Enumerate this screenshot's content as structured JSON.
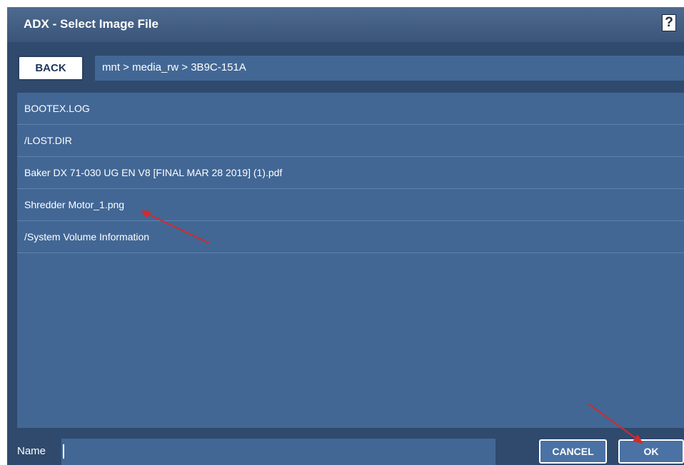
{
  "dialog": {
    "title": "ADX - Select Image File",
    "help_label": "?"
  },
  "navigation": {
    "back_label": "BACK",
    "path": "mnt > media_rw > 3B9C-151A"
  },
  "files": [
    "BOOTEX.LOG",
    "/LOST.DIR",
    "Baker DX 71-030 UG EN V8 [FINAL MAR 28 2019] (1).pdf",
    "Shredder Motor_1.png",
    "/System Volume Information"
  ],
  "footer": {
    "name_label": "Name",
    "name_value": "",
    "cancel_label": "CANCEL",
    "ok_label": "OK"
  },
  "colors": {
    "title_bar": "#3f5b80",
    "panel": "#426795",
    "frame": "#2f4a6d",
    "annotation_arrow": "#d42a2a"
  }
}
